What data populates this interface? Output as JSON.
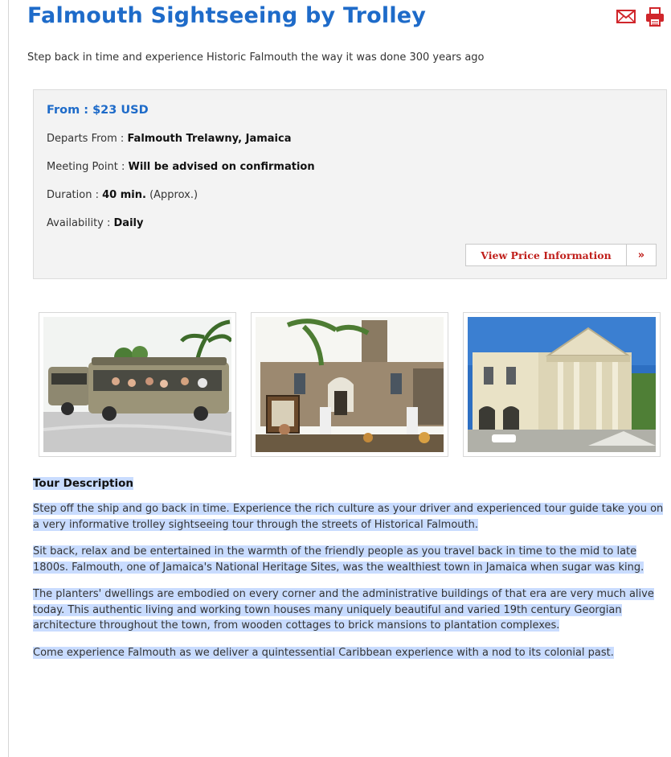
{
  "page": {
    "title": "Falmouth Sightseeing by Trolley",
    "subtitle": "Step back in time and experience Historic Falmouth the way it was done 300 years ago"
  },
  "tools": [
    {
      "icon": "email-icon",
      "color": "#d0262b"
    },
    {
      "icon": "print-icon",
      "color": "#d0262b"
    }
  ],
  "info": {
    "from_label": "From : $23 USD",
    "departs_label": "Departs From :",
    "departs_value": "Falmouth Trelawny, Jamaica",
    "meeting_label": "Meeting Point :",
    "meeting_value": "Will be advised on confirmation",
    "duration_label": "Duration :",
    "duration_value": "40 min.",
    "duration_note": "(Approx.)",
    "availability_label": "Availability :",
    "availability_value": "Daily",
    "price_button": "View Price Information",
    "price_button_arrow": "»"
  },
  "gallery": [
    {
      "subject": "trolley-photo"
    },
    {
      "subject": "church-photo"
    },
    {
      "subject": "courthouse-photo"
    }
  ],
  "description": {
    "heading": "Tour Description",
    "paragraphs": [
      "Step off the ship and go back in time. Experience the rich culture as your driver and experienced tour guide take you on a very informative trolley sightseeing tour through the streets of Historical Falmouth.",
      "Sit back, relax and be entertained in the warmth of the friendly people as you travel back in time to the mid to late 1800s. Falmouth, one of Jamaica's National Heritage Sites, was the wealthiest town in Jamaica when sugar was king.",
      "The planters' dwellings are embodied on every corner and the administrative buildings of that era are very much alive today. This authentic living and working town houses many uniquely beautiful and varied 19th century Georgian architecture throughout the town, from wooden cottages to brick mansions to plantation complexes.",
      "Come experience Falmouth as we deliver a quintessential Caribbean experience with a nod to its colonial past."
    ]
  },
  "colors": {
    "title_blue": "#1e6bc9",
    "link_red": "#c0201c",
    "highlight": "#c9dcff",
    "box_bg": "#f3f3f3"
  }
}
